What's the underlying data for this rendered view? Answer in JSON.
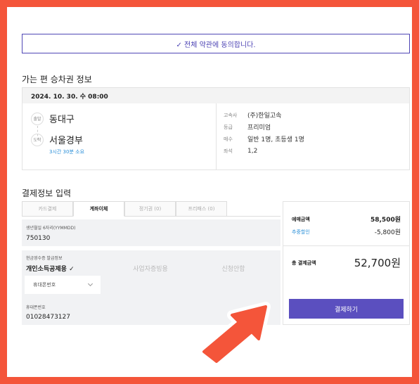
{
  "agreement": {
    "text": "✓ 전체 약관에 동의합니다."
  },
  "ticket_section": {
    "title": "가는 편 승차권 정보",
    "date": "2024. 10. 30. 수 08:00",
    "departure": {
      "badge": "출발",
      "name": "동대구"
    },
    "arrival": {
      "badge": "도착",
      "name": "서울경부"
    },
    "duration": "3시간 30분 소요",
    "info": [
      {
        "label": "고속사",
        "value": "(주)한일고속"
      },
      {
        "label": "등급",
        "value": "프리미엄"
      },
      {
        "label": "매수",
        "value": "일반 1명, 초등생 1명"
      },
      {
        "label": "좌석",
        "value": "1,2"
      }
    ]
  },
  "payment_section": {
    "title": "결제정보 입력",
    "tabs": [
      "카드결제",
      "계좌이체",
      "정기권 (0)",
      "프리패스 (0)"
    ],
    "active_tab": 1,
    "birth": {
      "label": "생년월일 6자리(YYMMDD)",
      "value": "750130"
    },
    "receipt": {
      "label": "현금영수증 발급정보",
      "options": [
        "개인소득공제용 ✓",
        "사업자증빙용",
        "신청안함"
      ],
      "select_value": "휴대폰번호"
    },
    "phone": {
      "label": "휴대폰번호",
      "value": "01028473127"
    }
  },
  "summary": {
    "price_label": "예매금액",
    "price_value": "58,500원",
    "discount_label": "추중할인",
    "discount_value": "-5,800원",
    "total_label": "총 결제금액",
    "total_value": "52,700원",
    "pay_button": "결제하기"
  },
  "colors": {
    "frame": "#f4553a",
    "accent": "#4f46b5",
    "button": "#5b4fbf",
    "link": "#2a8fd8"
  }
}
